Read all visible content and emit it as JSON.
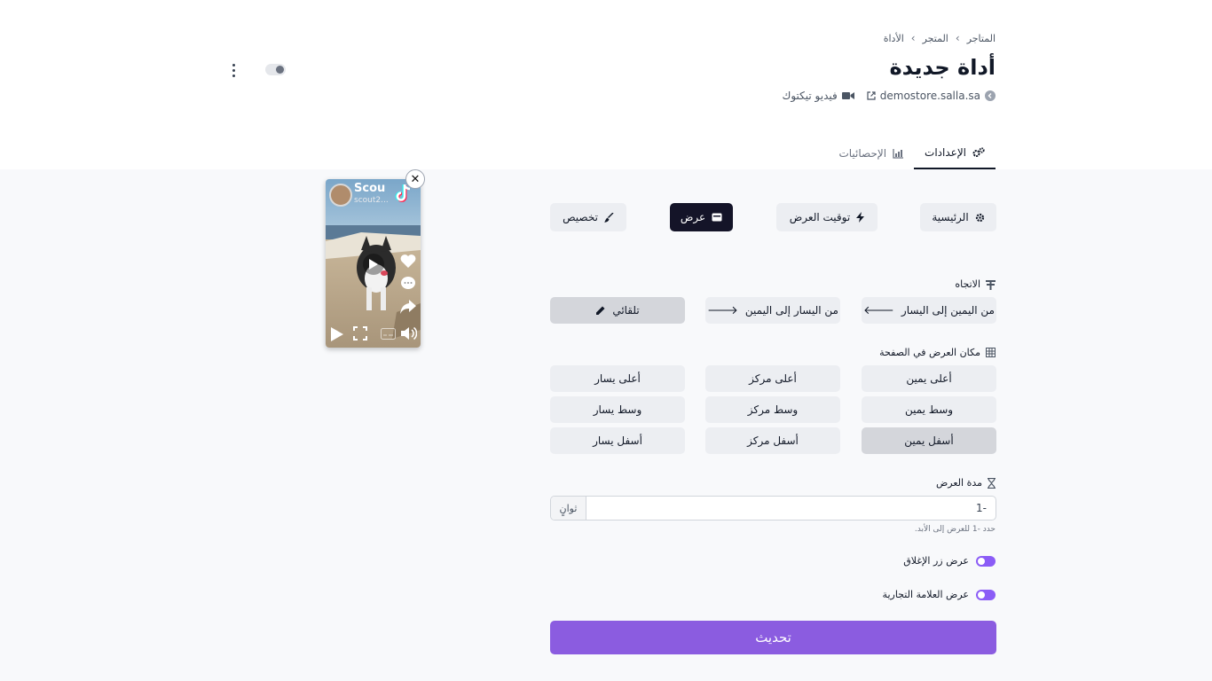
{
  "breadcrumb": {
    "items": [
      "المتاجر",
      "المتجر",
      "الأداة"
    ]
  },
  "page_title": "أداة جديدة",
  "meta": {
    "store_link": "demostore.salla.sa",
    "video_type": "فيديو تيكتوك"
  },
  "tabs": [
    {
      "label": "الإعدادات",
      "active": true
    },
    {
      "label": "الإحصائيات",
      "active": false
    }
  ],
  "nav_buttons": {
    "main": "الرئيسية",
    "timing": "توقيت العرض",
    "display": "عرض",
    "customize": "تخصيص"
  },
  "direction": {
    "label": "الاتجاه",
    "rtl": "من اليمين إلى اليسار",
    "ltr": "من اليسار إلى اليمين",
    "auto": "تلقائي"
  },
  "position": {
    "label": "مكان العرض في الصفحة",
    "top_right": "أعلى يمين",
    "top_center": "أعلى مركز",
    "top_left": "أعلى يسار",
    "mid_right": "وسط يمين",
    "mid_center": "وسط مركز",
    "mid_left": "وسط يسار",
    "bottom_right": "أسفل يمين",
    "bottom_center": "أسفل مركز",
    "bottom_left": "أسفل يسار"
  },
  "duration": {
    "label": "مدة العرض",
    "value": "-1",
    "unit": "ثوانٍ",
    "hint": "حدد -1 للعرض إلى الأبد."
  },
  "toggles": {
    "close_button": "عرض زر الإغلاق",
    "branding": "عرض العلامة التجارية"
  },
  "submit_label": "تحديث",
  "preview": {
    "user": "Scou",
    "handle": "scout2..."
  },
  "colors": {
    "accent": "#8b5ce0",
    "dark": "#141428",
    "toggle": "#8b5cf6"
  }
}
